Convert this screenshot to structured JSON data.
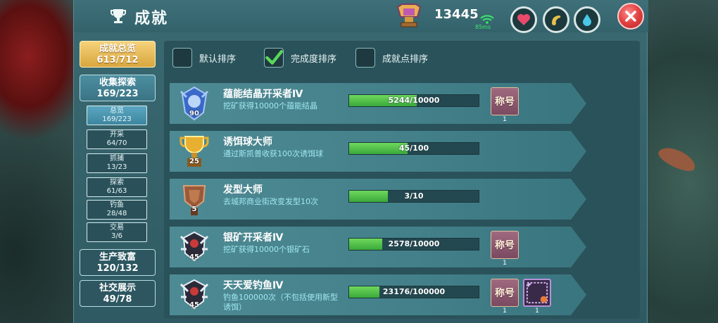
{
  "header": {
    "title": "成就",
    "points": "13445",
    "ping": "85ms"
  },
  "sidebar": {
    "main_categories": [
      {
        "label": "成就总览",
        "count": "613/712"
      },
      {
        "label": "收集探索",
        "count": "169/223"
      },
      {
        "label": "生产致富",
        "count": "120/132"
      },
      {
        "label": "社交展示",
        "count": "49/78"
      }
    ],
    "sub_items": [
      {
        "label": "总览",
        "count": "169/223"
      },
      {
        "label": "开采",
        "count": "64/70"
      },
      {
        "label": "抓捕",
        "count": "13/23"
      },
      {
        "label": "探索",
        "count": "61/63"
      },
      {
        "label": "钓鱼",
        "count": "28/48"
      },
      {
        "label": "交易",
        "count": "3/6"
      }
    ]
  },
  "filters": [
    {
      "label": "默认排序",
      "checked": false
    },
    {
      "label": "完成度排序",
      "checked": true
    },
    {
      "label": "成就点排序",
      "checked": false
    }
  ],
  "achievements": [
    {
      "name": "蕴能结晶开采者Ⅳ",
      "desc": "挖矿获得10000个蕴能结晶",
      "progress": "5244/10000",
      "fraction": 0.5244,
      "badge_points": "90",
      "badge": "blue-crest",
      "rewards": [
        {
          "label": "称号",
          "count": "1"
        }
      ]
    },
    {
      "name": "诱饵球大师",
      "desc": "通过斯凯普收获100次诱饵球",
      "progress": "45/100",
      "fraction": 0.45,
      "badge_points": "25",
      "badge": "gold-cup",
      "rewards": []
    },
    {
      "name": "发型大师",
      "desc": "去城邦商业街改变发型10次",
      "progress": "3/10",
      "fraction": 0.3,
      "badge_points": "5",
      "badge": "bronze-shield",
      "rewards": []
    },
    {
      "name": "银矿开采者Ⅳ",
      "desc": "挖矿获得10000个银矿石",
      "progress": "2578/10000",
      "fraction": 0.2578,
      "badge_points": "45",
      "badge": "silver-crest",
      "rewards": [
        {
          "label": "称号",
          "count": "1"
        }
      ]
    },
    {
      "name": "天天爱钓鱼Ⅳ",
      "desc": "钓鱼100000次（不包括使用新型诱饵）",
      "progress": "23176/100000",
      "fraction": 0.23176,
      "badge_points": "45",
      "badge": "silver-crest",
      "rewards": [
        {
          "label": "称号",
          "count": "1"
        },
        {
          "label": "",
          "count": "1"
        }
      ]
    }
  ],
  "colors": {
    "panel": "#3b6a72",
    "progress_fill": "#4cbe44",
    "gold_button": "#e6b854",
    "close_button": "#e04040"
  }
}
